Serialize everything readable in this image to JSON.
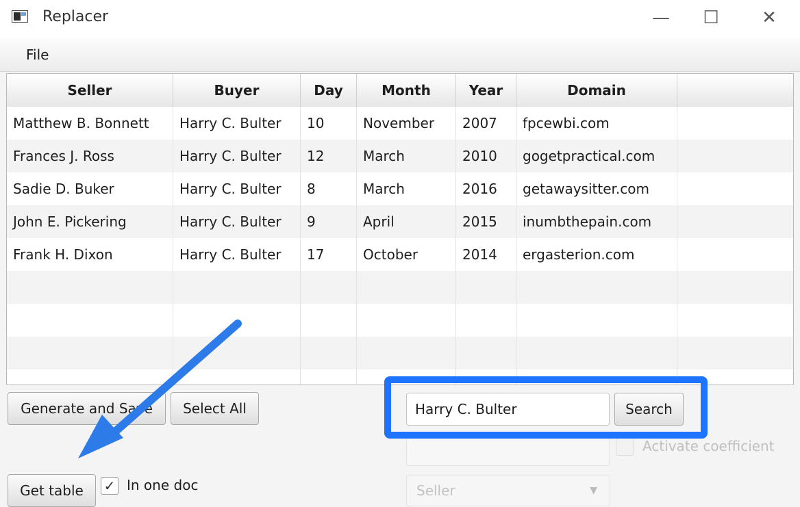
{
  "window": {
    "title": "Replacer",
    "controls": {
      "minimize": "—",
      "maximize": "☐",
      "close": "✕"
    }
  },
  "menu": {
    "file": "File"
  },
  "table": {
    "columns": [
      "Seller",
      "Buyer",
      "Day",
      "Month",
      "Year",
      "Domain",
      ""
    ],
    "rows": [
      [
        "Matthew B. Bonnett",
        "Harry C. Bulter",
        "10",
        "November",
        "2007",
        "fpcewbi.com"
      ],
      [
        "Frances J. Ross",
        "Harry C. Bulter",
        "12",
        "March",
        "2010",
        "gogetpractical.com"
      ],
      [
        "Sadie D. Buker",
        "Harry C. Bulter",
        "8",
        "March",
        "2016",
        "getawaysitter.com"
      ],
      [
        "John E. Pickering",
        "Harry C. Bulter",
        "9",
        "April",
        "2015",
        "inumbthepain.com"
      ],
      [
        "Frank H. Dixon",
        "Harry C. Bulter",
        "17",
        "October",
        "2014",
        "ergasterion.com"
      ]
    ],
    "empty_rows": 4
  },
  "buttons": {
    "generate_and_save": "Generate and Save",
    "select_all": "Select All",
    "get_table": "Get table",
    "search": "Search"
  },
  "checkboxes": {
    "in_one_doc": {
      "label": "In one doc",
      "checked": true
    },
    "activate_coefficient": {
      "label": "Activate coefficient",
      "checked": false,
      "disabled": true
    }
  },
  "search": {
    "value": "Harry C. Bulter"
  },
  "coefficient_input": {
    "value": ""
  },
  "field_select": {
    "value": "Seller"
  },
  "annotations": {
    "highlight_color": "#1e73ff",
    "arrow_color": "#2d7be8"
  },
  "colors": {
    "header_bg": "#e9e9e9",
    "alt_row": "#f3f3f3"
  }
}
